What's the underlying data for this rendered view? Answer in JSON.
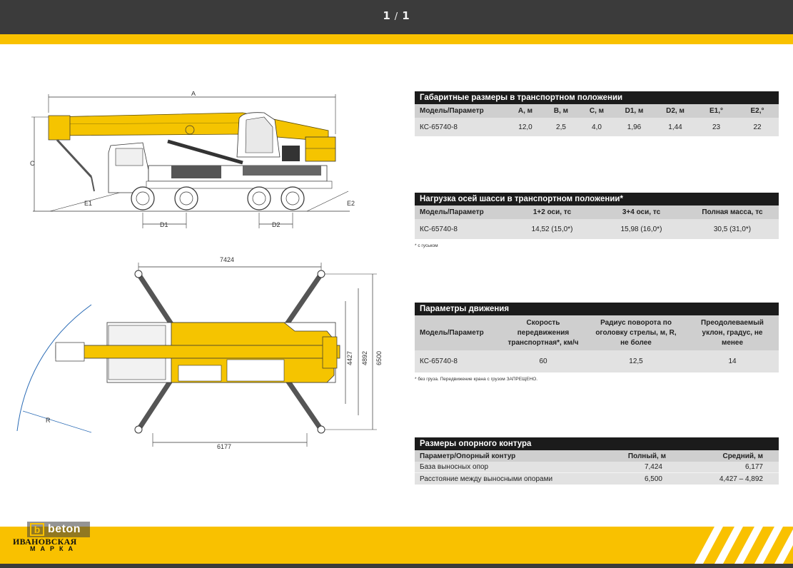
{
  "viewer": {
    "page_current": "1",
    "page_sep": "/",
    "page_total": "1"
  },
  "side_view": {
    "dims": {
      "a": "A",
      "c": "C",
      "e1": "E1",
      "e2": "E2",
      "d1": "D1",
      "d2": "D2"
    }
  },
  "top_view": {
    "dims": {
      "outrigger_base_full": "7424",
      "outrigger_base_mid": "6177",
      "span_full": "6500",
      "span_mid_a": "4892",
      "span_mid_b": "4427",
      "radius": "R"
    }
  },
  "table_dimensions": {
    "title": "Габаритные размеры в транспортном положении",
    "headers": [
      "Модель/Параметр",
      "А, м",
      "В, м",
      "С, м",
      "D1, м",
      "D2, м",
      "E1,°",
      "E2,°"
    ],
    "row": [
      "КС-65740-8",
      "12,0",
      "2,5",
      "4,0",
      "1,96",
      "1,44",
      "23",
      "22"
    ]
  },
  "table_axle_load": {
    "title": "Нагрузка осей шасси в транспортном положении*",
    "headers": [
      "Модель/Параметр",
      "1+2 оси, тс",
      "3+4 оси, тс",
      "Полная масса, тс"
    ],
    "row": [
      "КС-65740-8",
      "14,52 (15,0*)",
      "15,98 (16,0*)",
      "30,5 (31,0*)"
    ],
    "note": "* с гуськом"
  },
  "table_motion": {
    "title": "Параметры движения",
    "headers": [
      "Модель/Параметр",
      "Скорость передвижения транспортная*, км/ч",
      "Радиус поворота по оголовку стрелы, м, R, не более",
      "Преодолеваемый уклон, градус, не менее"
    ],
    "row": [
      "КС-65740-8",
      "60",
      "12,5",
      "14"
    ],
    "note": "* без груза. Передвижение крана с грузом ЗАПРЕЩЕНО."
  },
  "table_support": {
    "title": "Размеры опорного контура",
    "headers": [
      "Параметр/Опорный контур",
      "Полный, м",
      "Средний, м"
    ],
    "rows": [
      [
        "База выносных опор",
        "7,424",
        "6,177"
      ],
      [
        "Расстояние между выносными опорами",
        "6,500",
        "4,427 – 4,892"
      ]
    ]
  },
  "footer": {
    "logo_badge": "beton",
    "logo_line1": "ИВАНОВСКАЯ",
    "logo_line2": "МАРКА"
  },
  "colors": {
    "accent": "#f9c100",
    "dark": "#3b3b3b",
    "table_header": "#1b1b1b",
    "crane_yellow": "#f5c400"
  }
}
